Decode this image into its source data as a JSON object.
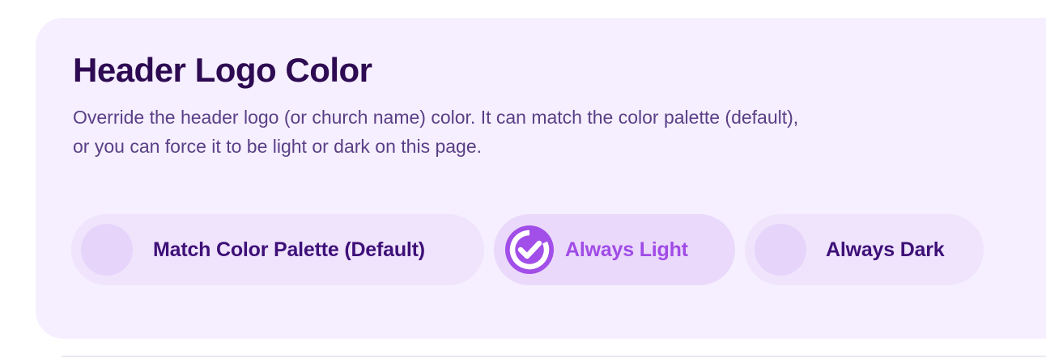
{
  "section": {
    "title": "Header Logo Color",
    "description": "Override the header logo (or church name) color. It can match the color palette (default), or you can force it to be light or dark on this page."
  },
  "options": [
    {
      "label": "Match Color Palette (Default)",
      "selected": false
    },
    {
      "label": "Always Light",
      "selected": true
    },
    {
      "label": "Always Dark",
      "selected": false
    }
  ],
  "icons": {
    "selected": "check-circle-icon"
  },
  "colors": {
    "card_background": "#f5efff",
    "title": "#2d0a52",
    "description": "#5a3f86",
    "option_label": "#3e0f78",
    "selected_accent": "#a04be6"
  }
}
